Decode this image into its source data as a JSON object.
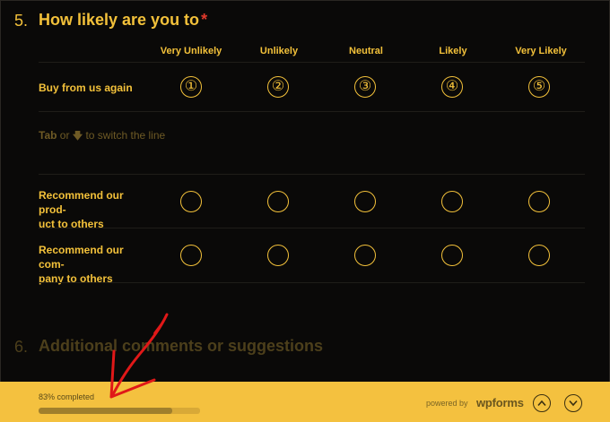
{
  "question5": {
    "number": "5.",
    "title": "How likely are you to",
    "required_mark": "*",
    "columns": [
      "Very Unlikely",
      "Unlikely",
      "Neutral",
      "Likely",
      "Very Likely"
    ],
    "rows": [
      {
        "label": "Buy from us again",
        "selected_style": "numbered",
        "options": [
          "①",
          "②",
          "③",
          "④",
          "⑤"
        ]
      },
      {
        "label": "Recommend our product to others",
        "label_lines": [
          "Recommend our prod-",
          "uct to others"
        ]
      },
      {
        "label": "Recommend our company to others",
        "label_lines": [
          "Recommend our com-",
          "pany to others"
        ]
      }
    ],
    "hint": {
      "prefix": "Tab",
      "middle": "or",
      "arrow": "🡇",
      "suffix": "to switch the line"
    }
  },
  "question6": {
    "number": "6.",
    "title": "Additional comments or suggestions"
  },
  "footer": {
    "progress_text": "83% completed",
    "progress_value": 0.83,
    "powered_by": "powered by",
    "brand": "wpforms",
    "up_icon": "chevron-up-icon",
    "down_icon": "chevron-down-icon"
  },
  "colors": {
    "accent": "#f3c13a",
    "background": "#0a0908",
    "footer": "#f4c13f",
    "required": "#e0392b",
    "annotation": "#e01818"
  }
}
